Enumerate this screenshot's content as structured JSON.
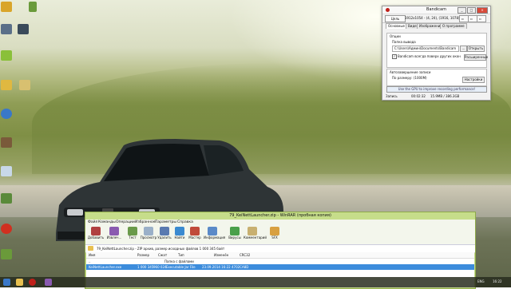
{
  "bandicam": {
    "title": "Bandicam",
    "window_controls": [
      "_",
      "□",
      "×"
    ],
    "toolbar": {
      "target_button": "Цель",
      "resolution": "1912x1054 - (4, 24), (1916, 1078)",
      "extra_buttons": [
        "▫",
        "▫",
        "▫"
      ]
    },
    "tabs": [
      "Основные",
      "Видео",
      "Изображение",
      "О программе"
    ],
    "options": {
      "section": "Опции",
      "output_folder_label": "Папка вывода",
      "output_folder_value": "C:\\Users\\Админ\\Documents\\Bandicam",
      "dots_button": "...",
      "open_button": "Открыть",
      "always_on_top": "Bandicam всегда поверх других окон",
      "always_on_top_checked": true,
      "advanced_button": "Расширенные"
    },
    "autostart": {
      "section": "Автозавершение записи",
      "value": "По размеру: (1000M)",
      "settings_button": "Настройки"
    },
    "gpu_hint": "Use the GPU to improve recording performance!",
    "status": {
      "label": "Запись",
      "time": "00:02:32",
      "size": "15.9MB / 386.3GB"
    }
  },
  "winrar": {
    "title": "79_KeiNettLauncher.zip - WinRAR (пробная копия)",
    "menu": [
      "Файл",
      "Команды",
      "Операции",
      "Избранное",
      "Параметры",
      "Справка"
    ],
    "tools": [
      "Добавить",
      "Извлеч...",
      "Тест",
      "Просмотр",
      "Удалить",
      "Найти",
      "Мастер",
      "Информация",
      "Вирусы",
      "Комментарий",
      "SFX"
    ],
    "path": "79_KeiNettLauncher.zip - ZIP архив, размер исходных файлов 1 000 345 байт",
    "columns": [
      "Имя",
      "Размер",
      "Сжат",
      "Тип",
      "Изменён",
      "CRC32"
    ],
    "rows": [
      {
        "name": "..",
        "size": "",
        "packed": "",
        "type": "Папка с файлами",
        "modified": "",
        "crc": ""
      },
      {
        "name": "KeiNettLauncher.exe",
        "size": "1 000 345",
        "packed": "960 024",
        "type": "Executable Jar File",
        "modified": "23.09.2014 16:22",
        "crc": "4702CA8D"
      }
    ]
  },
  "taskbar": {
    "lang": "ENG",
    "time": "16:22"
  },
  "colors": {
    "winrar_frame": "#c6dd8a",
    "selection": "#3c8cdc",
    "record_dot": "#c0201a"
  }
}
